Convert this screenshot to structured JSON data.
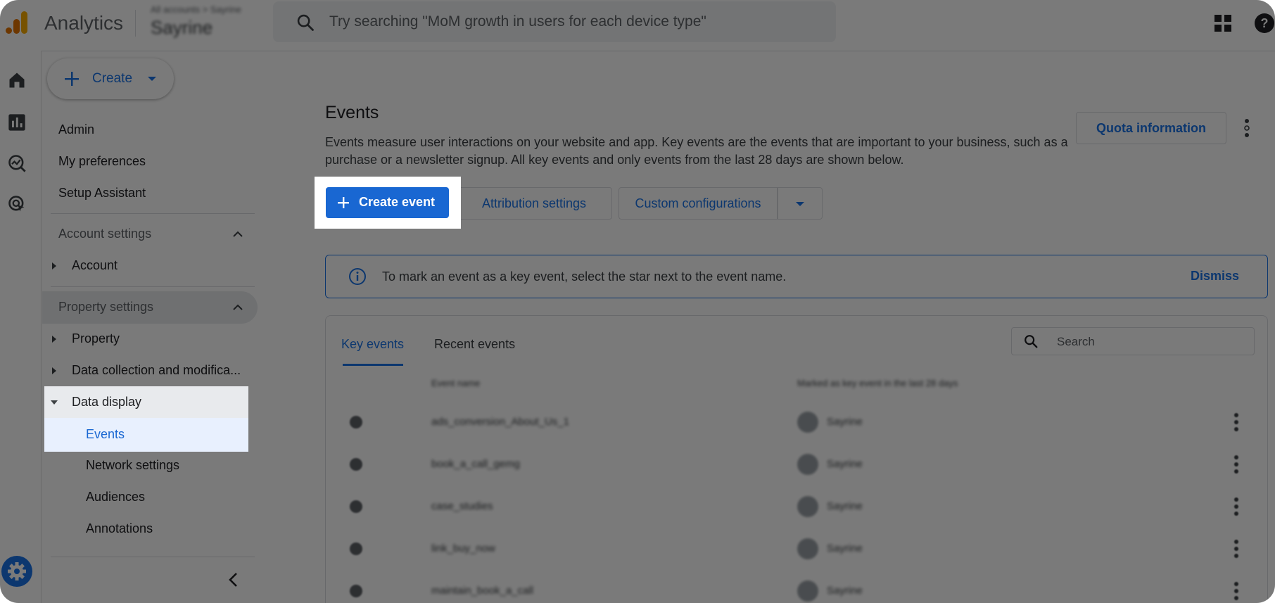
{
  "topbar": {
    "app_name": "Analytics",
    "account_path": "All accounts > Sayrine",
    "property_name": "Sayrine",
    "search_placeholder": "Try searching \"MoM growth in users for each device type\""
  },
  "sidebar": {
    "create_label": "Create",
    "items": {
      "admin": "Admin",
      "preferences": "My preferences",
      "setup": "Setup Assistant"
    },
    "account_settings": {
      "heading": "Account settings",
      "account": "Account"
    },
    "property_settings": {
      "heading": "Property settings",
      "property": "Property",
      "data_collection": "Data collection and modifica...",
      "data_display": "Data display",
      "events": "Events",
      "network": "Network settings",
      "audiences": "Audiences",
      "annotations": "Annotations"
    }
  },
  "main": {
    "title": "Events",
    "description": "Events measure user interactions on your website and app. Key events are the events that are important to your business, such as a purchase or a newsletter signup. All key events and only events from the last 28 days are shown below.",
    "quota_button": "Quota information",
    "create_event_button": "Create event",
    "attribution_button": "Attribution settings",
    "custom_config_button": "Custom configurations",
    "banner": {
      "text": "To mark an event as a key event, select the star next to the event name.",
      "dismiss": "Dismiss"
    },
    "tabs": [
      "Key events",
      "Recent events"
    ],
    "table_search_placeholder": "Search",
    "columns": [
      "Event name",
      "Marked as key event in the last 28 days"
    ],
    "rows": [
      {
        "name": "ads_conversion_About_Us_1",
        "owner": "Sayrine"
      },
      {
        "name": "book_a_call_gemg",
        "owner": "Sayrine"
      },
      {
        "name": "case_studies",
        "owner": "Sayrine"
      },
      {
        "name": "link_buy_now",
        "owner": "Sayrine"
      },
      {
        "name": "maintain_book_a_call",
        "owner": "Sayrine"
      }
    ]
  },
  "colors": {
    "accent": "#1a73e8",
    "primary_button": "#1967d2",
    "text": "#202124",
    "overlay": "rgba(0,0,0,0.52)"
  }
}
